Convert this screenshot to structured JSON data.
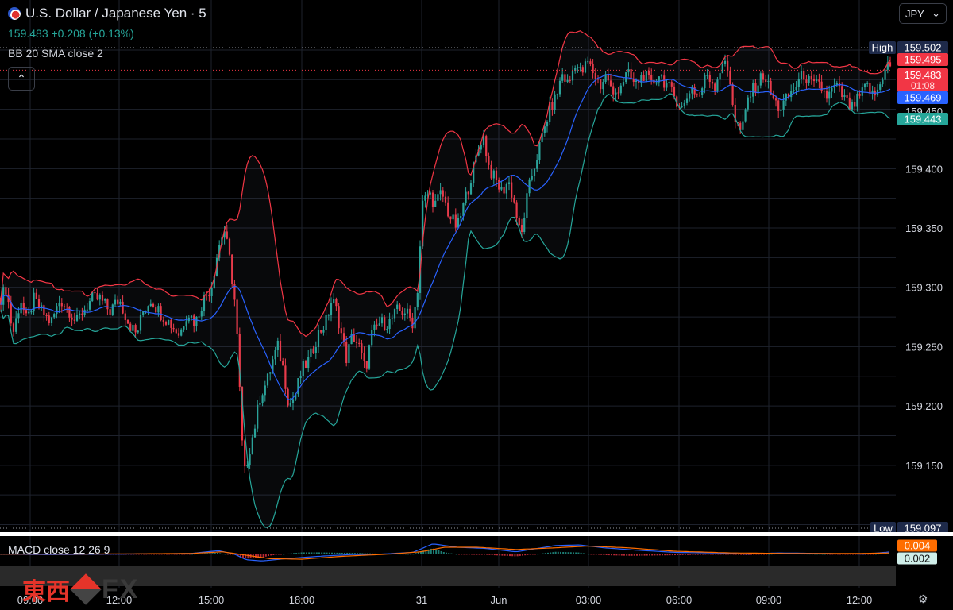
{
  "header": {
    "title": "U.S. Dollar / Japanese Yen · 5",
    "price": "159.483",
    "change": "+0.208 (+0.13%)",
    "indicator": "BB 20 SMA close 2",
    "collapse_glyph": "⌃",
    "currency": "JPY",
    "currency_caret": "⌄"
  },
  "macd": {
    "label": "MACD close 12 26 9"
  },
  "watermark": {
    "kanji": "東西",
    "fx": "FX"
  },
  "colors": {
    "up": "#26a69a",
    "down": "#f23645",
    "bb_upper": "#f23645",
    "bb_lower": "#26a69a",
    "bb_basis": "#2962ff",
    "macd_line": "#2962ff",
    "signal_line": "#ff6d00"
  },
  "chart_data": {
    "type": "candlestick",
    "symbol": "USDJPY",
    "timeframe": "5",
    "ylim": [
      159.095,
      159.51
    ],
    "ytick_labels": [
      "159.400",
      "159.350",
      "159.300",
      "159.250",
      "159.200",
      "159.150"
    ],
    "xtick_labels": [
      "09:00",
      "12:00",
      "15:00",
      "18:00",
      "31",
      "Jun",
      "03:00",
      "06:00",
      "09:00",
      "12:00"
    ],
    "high": {
      "label": "High",
      "value": "159.502"
    },
    "low": {
      "label": "Low",
      "value": "159.097"
    },
    "price_tags": [
      {
        "value": "159.495",
        "kind": "bb-upper"
      },
      {
        "value": "159.483",
        "kind": "last",
        "countdown": "01:08"
      },
      {
        "value": "159.469",
        "kind": "bb-basis"
      },
      {
        "value": "159.450",
        "kind": "tick"
      },
      {
        "value": "159.443",
        "kind": "bb-lower"
      }
    ],
    "macd_tags": [
      {
        "value": "0.004",
        "kind": "macd"
      },
      {
        "value": "0.002",
        "kind": "hist"
      }
    ],
    "close_path": [
      [
        0,
        159.29
      ],
      [
        8,
        159.3
      ],
      [
        16,
        159.26
      ],
      [
        26,
        159.29
      ],
      [
        34,
        159.27
      ],
      [
        42,
        159.29
      ],
      [
        52,
        159.28
      ],
      [
        64,
        159.27
      ],
      [
        76,
        159.29
      ],
      [
        88,
        159.28
      ],
      [
        96,
        159.27
      ],
      [
        104,
        159.28
      ],
      [
        116,
        159.29
      ],
      [
        126,
        159.29
      ],
      [
        138,
        159.28
      ],
      [
        150,
        159.29
      ],
      [
        162,
        159.27
      ],
      [
        172,
        159.26
      ],
      [
        180,
        159.28
      ],
      [
        190,
        159.29
      ],
      [
        200,
        159.28
      ],
      [
        214,
        159.27
      ],
      [
        226,
        159.26
      ],
      [
        236,
        159.28
      ],
      [
        246,
        159.27
      ],
      [
        256,
        159.29
      ],
      [
        266,
        159.3
      ],
      [
        274,
        159.33
      ],
      [
        282,
        159.35
      ],
      [
        290,
        159.32
      ],
      [
        297,
        159.28
      ],
      [
        302,
        159.21
      ],
      [
        307,
        159.14
      ],
      [
        313,
        159.16
      ],
      [
        320,
        159.18
      ],
      [
        328,
        159.21
      ],
      [
        336,
        159.22
      ],
      [
        344,
        159.24
      ],
      [
        350,
        159.25
      ],
      [
        357,
        159.23
      ],
      [
        364,
        159.2
      ],
      [
        372,
        159.21
      ],
      [
        380,
        159.23
      ],
      [
        390,
        159.24
      ],
      [
        400,
        159.26
      ],
      [
        410,
        159.27
      ],
      [
        418,
        159.29
      ],
      [
        424,
        159.28
      ],
      [
        430,
        159.26
      ],
      [
        436,
        159.24
      ],
      [
        444,
        159.26
      ],
      [
        452,
        159.25
      ],
      [
        460,
        159.23
      ],
      [
        468,
        159.26
      ],
      [
        478,
        159.27
      ],
      [
        490,
        159.27
      ],
      [
        500,
        159.28
      ],
      [
        510,
        159.28
      ],
      [
        520,
        159.27
      ],
      [
        526,
        159.3
      ],
      [
        532,
        159.37
      ],
      [
        540,
        159.38
      ],
      [
        548,
        159.37
      ],
      [
        556,
        159.38
      ],
      [
        566,
        159.36
      ],
      [
        576,
        159.35
      ],
      [
        584,
        159.37
      ],
      [
        592,
        159.39
      ],
      [
        600,
        159.41
      ],
      [
        608,
        159.43
      ],
      [
        616,
        159.4
      ],
      [
        624,
        159.39
      ],
      [
        632,
        159.38
      ],
      [
        640,
        159.39
      ],
      [
        648,
        159.37
      ],
      [
        656,
        159.34
      ],
      [
        662,
        159.37
      ],
      [
        668,
        159.39
      ],
      [
        676,
        159.41
      ],
      [
        684,
        159.43
      ],
      [
        692,
        159.45
      ],
      [
        700,
        159.46
      ],
      [
        708,
        159.48
      ],
      [
        716,
        159.47
      ],
      [
        724,
        159.49
      ],
      [
        732,
        159.48
      ],
      [
        740,
        159.49
      ],
      [
        748,
        159.48
      ],
      [
        756,
        159.47
      ],
      [
        764,
        159.48
      ],
      [
        772,
        159.46
      ],
      [
        780,
        159.47
      ],
      [
        790,
        159.48
      ],
      [
        800,
        159.47
      ],
      [
        810,
        159.48
      ],
      [
        820,
        159.47
      ],
      [
        830,
        159.48
      ],
      [
        840,
        159.47
      ],
      [
        850,
        159.46
      ],
      [
        860,
        159.45
      ],
      [
        870,
        159.47
      ],
      [
        880,
        159.46
      ],
      [
        890,
        159.48
      ],
      [
        900,
        159.47
      ],
      [
        910,
        159.49
      ],
      [
        918,
        159.48
      ],
      [
        926,
        159.44
      ],
      [
        934,
        159.43
      ],
      [
        942,
        159.46
      ],
      [
        952,
        159.47
      ],
      [
        962,
        159.48
      ],
      [
        972,
        159.46
      ],
      [
        982,
        159.45
      ],
      [
        992,
        159.46
      ],
      [
        1002,
        159.47
      ],
      [
        1012,
        159.48
      ],
      [
        1022,
        159.47
      ],
      [
        1032,
        159.47
      ],
      [
        1042,
        159.46
      ],
      [
        1052,
        159.47
      ],
      [
        1062,
        159.46
      ],
      [
        1072,
        159.45
      ],
      [
        1082,
        159.46
      ],
      [
        1092,
        159.47
      ],
      [
        1100,
        159.46
      ],
      [
        1108,
        159.47
      ],
      [
        1116,
        159.49
      ],
      [
        1122,
        159.483
      ]
    ],
    "macd_path": [
      [
        0,
        0.0
      ],
      [
        60,
        -0.001
      ],
      [
        150,
        0.0
      ],
      [
        240,
        0.001
      ],
      [
        275,
        0.006
      ],
      [
        295,
        0.0
      ],
      [
        310,
        -0.01
      ],
      [
        330,
        -0.012
      ],
      [
        360,
        -0.008
      ],
      [
        400,
        -0.004
      ],
      [
        440,
        -0.001
      ],
      [
        480,
        0.0
      ],
      [
        520,
        0.003
      ],
      [
        545,
        0.018
      ],
      [
        575,
        0.012
      ],
      [
        610,
        0.01
      ],
      [
        650,
        0.004
      ],
      [
        700,
        0.015
      ],
      [
        730,
        0.016
      ],
      [
        760,
        0.011
      ],
      [
        800,
        0.007
      ],
      [
        850,
        0.003
      ],
      [
        900,
        0.002
      ],
      [
        940,
        0.0
      ],
      [
        980,
        0.002
      ],
      [
        1040,
        0.001
      ],
      [
        1090,
        0.0
      ],
      [
        1122,
        0.004
      ]
    ],
    "signal_path": [
      [
        0,
        0.0
      ],
      [
        100,
        0.0
      ],
      [
        240,
        0.001
      ],
      [
        280,
        0.004
      ],
      [
        310,
        -0.002
      ],
      [
        340,
        -0.008
      ],
      [
        380,
        -0.009
      ],
      [
        430,
        -0.004
      ],
      [
        490,
        0.0
      ],
      [
        530,
        0.004
      ],
      [
        560,
        0.012
      ],
      [
        600,
        0.012
      ],
      [
        650,
        0.008
      ],
      [
        700,
        0.011
      ],
      [
        740,
        0.014
      ],
      [
        790,
        0.011
      ],
      [
        850,
        0.005
      ],
      [
        920,
        0.002
      ],
      [
        1000,
        0.001
      ],
      [
        1080,
        0.001
      ],
      [
        1122,
        0.002
      ]
    ],
    "macd_ylim": [
      -0.02,
      0.03
    ]
  }
}
